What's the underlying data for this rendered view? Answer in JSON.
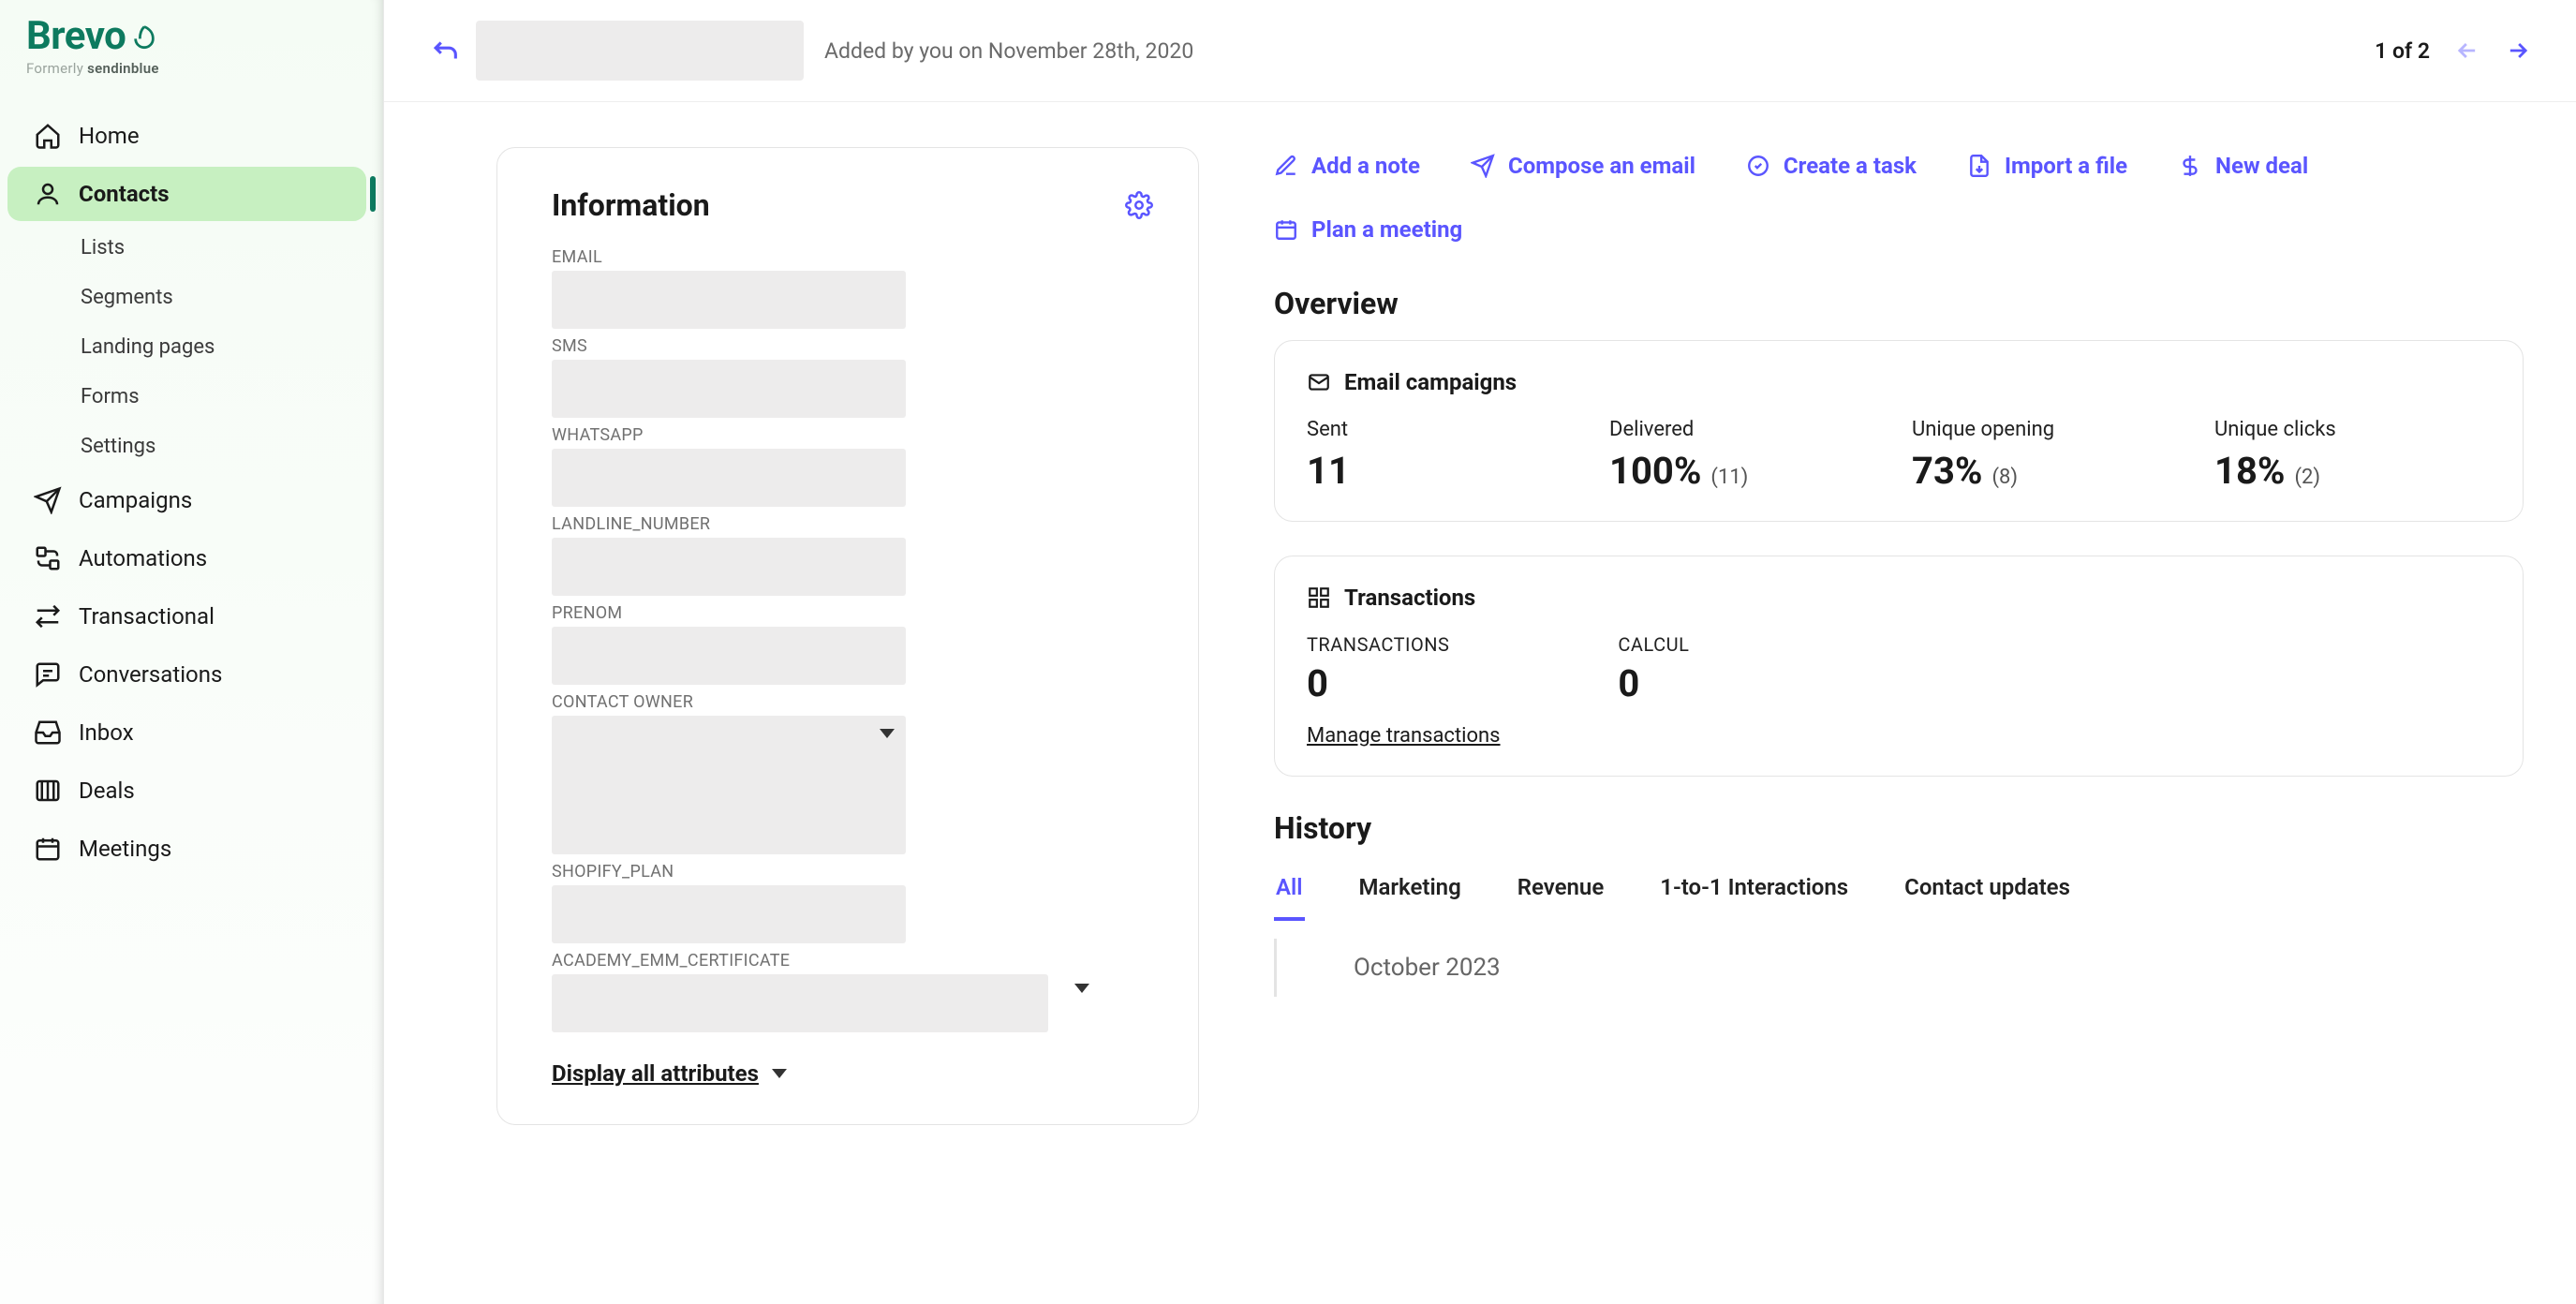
{
  "brand": {
    "name": "Brevo",
    "sub_prefix": "Formerly ",
    "sub_bold": "sendinblue"
  },
  "sidebar": {
    "items": [
      {
        "label": "Home",
        "icon": "home-icon"
      },
      {
        "label": "Contacts",
        "icon": "contacts-icon",
        "active": true
      },
      {
        "label": "Campaigns",
        "icon": "campaigns-icon"
      },
      {
        "label": "Automations",
        "icon": "automations-icon"
      },
      {
        "label": "Transactional",
        "icon": "transactional-icon"
      },
      {
        "label": "Conversations",
        "icon": "conversations-icon"
      },
      {
        "label": "Inbox",
        "icon": "inbox-icon"
      },
      {
        "label": "Deals",
        "icon": "deals-icon"
      },
      {
        "label": "Meetings",
        "icon": "meetings-icon"
      }
    ],
    "contacts_sub": [
      "Lists",
      "Segments",
      "Landing pages",
      "Forms",
      "Settings"
    ]
  },
  "topbar": {
    "added_by": "Added by you on November 28th, 2020",
    "pager": "1 of 2"
  },
  "info": {
    "title": "Information",
    "attrs": [
      {
        "label": "EMAIL"
      },
      {
        "label": "SMS"
      },
      {
        "label": "WHATSAPP"
      },
      {
        "label": "LANDLINE_NUMBER"
      },
      {
        "label": "PRENOM"
      },
      {
        "label": "CONTACT OWNER",
        "variant": "tall"
      },
      {
        "label": "SHOPIFY_PLAN"
      },
      {
        "label": "ACADEMY_EMM_CERTIFICATE",
        "variant": "wide"
      }
    ],
    "display_all": "Display all attributes"
  },
  "actions": [
    {
      "label": "Add a note",
      "icon": "note-icon"
    },
    {
      "label": "Compose an email",
      "icon": "send-icon"
    },
    {
      "label": "Create a task",
      "icon": "task-icon"
    },
    {
      "label": "Import a file",
      "icon": "import-icon"
    },
    {
      "label": "New deal",
      "icon": "dollar-icon"
    },
    {
      "label": "Plan a meeting",
      "icon": "calendar-icon"
    }
  ],
  "overview": {
    "title": "Overview",
    "email_card": {
      "title": "Email campaigns",
      "stats": [
        {
          "label": "Sent",
          "value": "11",
          "sub": ""
        },
        {
          "label": "Delivered",
          "value": "100%",
          "sub": "(11)"
        },
        {
          "label": "Unique opening",
          "value": "73%",
          "sub": "(8)"
        },
        {
          "label": "Unique clicks",
          "value": "18%",
          "sub": "(2)"
        }
      ]
    },
    "tx_card": {
      "title": "Transactions",
      "items": [
        {
          "label": "TRANSACTIONS",
          "value": "0"
        },
        {
          "label": "CALCUL",
          "value": "0"
        }
      ],
      "manage": "Manage transactions"
    }
  },
  "history": {
    "title": "History",
    "tabs": [
      "All",
      "Marketing",
      "Revenue",
      "1-to-1 Interactions",
      "Contact updates"
    ],
    "active_tab": 0,
    "timeline_month": "October 2023"
  },
  "colors": {
    "accent": "#5a55ff",
    "brand": "#0d7a5f",
    "sidebar_active": "#c7f0c1"
  }
}
